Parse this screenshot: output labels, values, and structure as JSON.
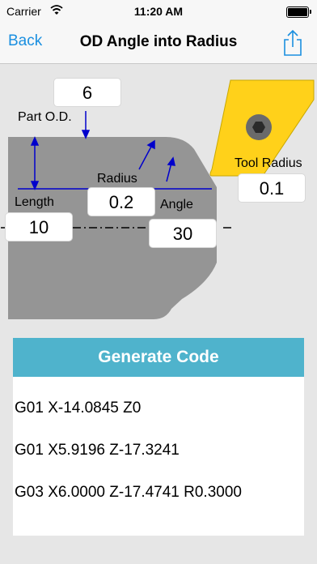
{
  "status": {
    "carrier": "Carrier",
    "time": "11:20 AM"
  },
  "nav": {
    "back_label": "Back",
    "title": "OD Angle into Radius"
  },
  "diagram": {
    "part_od_label": "Part O.D.",
    "part_od_value": "6",
    "radius_label": "Radius",
    "radius_value": "0.2",
    "length_label": "Length",
    "length_value": "10",
    "angle_label": "Angle",
    "angle_value": "30",
    "tool_radius_label": "Tool Radius",
    "tool_radius_value": "0.1"
  },
  "generate_label": "Generate Code",
  "code_lines": [
    "G01 X-14.0845 Z0",
    "G01 X5.9196 Z-17.3241",
    "G03 X6.0000 Z-17.4741 R0.3000"
  ],
  "colors": {
    "accent": "#1a8fe0",
    "button": "#4fb3cc",
    "insert": "#ffd11a",
    "part": "#959595",
    "dimension": "#0000cc"
  }
}
